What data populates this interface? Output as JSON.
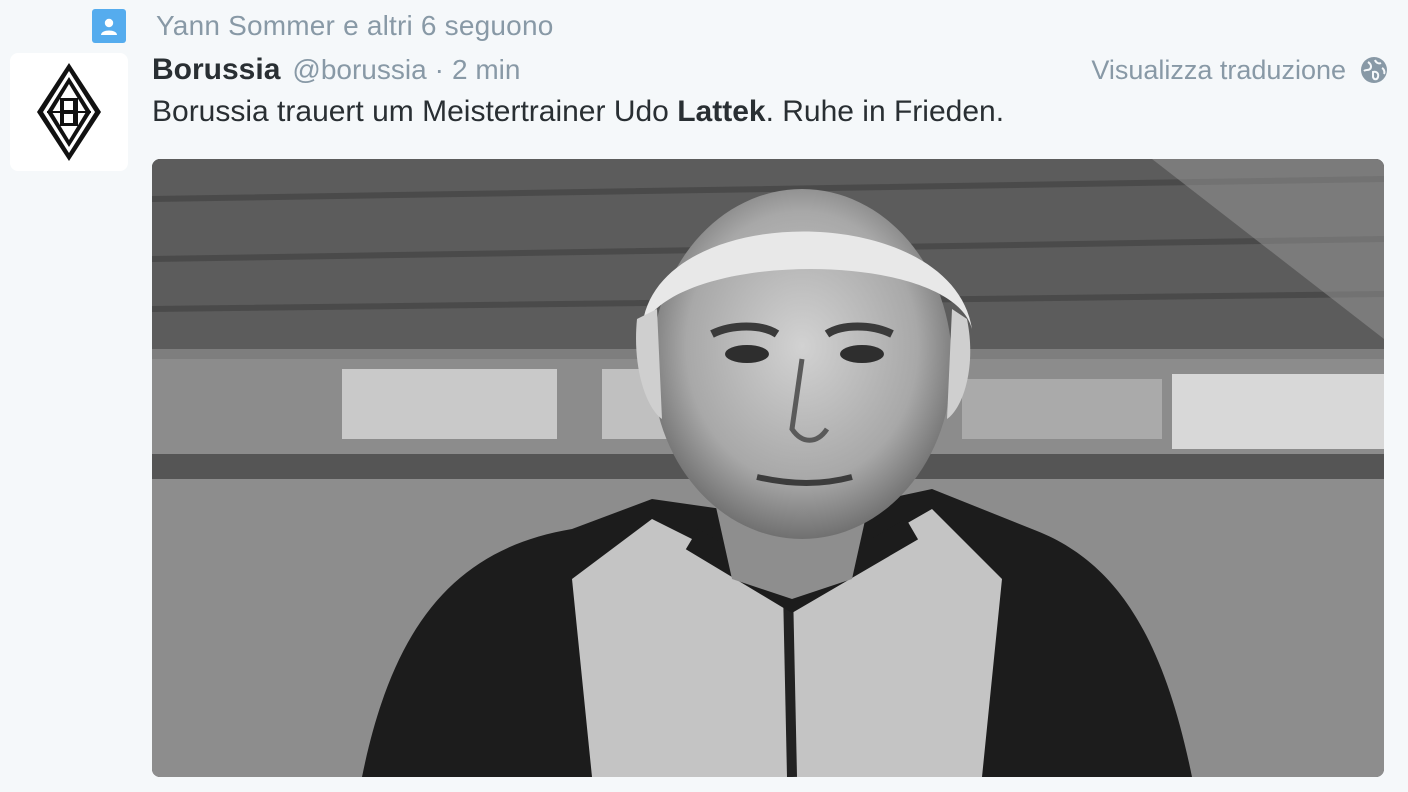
{
  "context": {
    "icon": "person-icon",
    "text": "Yann Sommer e altri 6 seguono",
    "accent": "#55acee"
  },
  "avatar": {
    "icon": "borussia-logo"
  },
  "tweet": {
    "name": "Borussia",
    "handle": "@borussia",
    "separator": "·",
    "time": "2 min",
    "translate_label": "Visualizza traduzione",
    "translate_icon": "globe-icon",
    "text_before": "Borussia trauert um Meistertrainer Udo ",
    "text_bold": "Lattek",
    "text_after": ". Ruhe in Frieden."
  },
  "media": {
    "description_icon": "photo"
  },
  "colors": {
    "background": "#f5f8fa",
    "muted": "#8899a6",
    "text": "#292f33"
  }
}
